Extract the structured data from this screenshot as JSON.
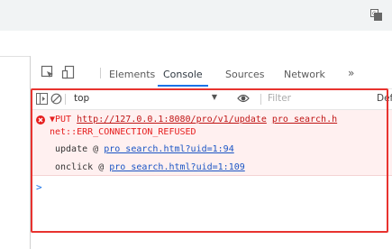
{
  "browser": {
    "translate_icon": "translate-icon"
  },
  "devtools": {
    "tabs": [
      "Elements",
      "Console",
      "Sources",
      "Network"
    ],
    "active_tab": "Console",
    "more_tabs": "»",
    "icons": [
      "inspect-element-icon",
      "device-toggle-icon"
    ]
  },
  "console_toolbar": {
    "context": "top",
    "filter_placeholder": "Filter",
    "levels": "Def"
  },
  "error": {
    "method": "▼PUT",
    "url": "http://127.0.0.1:8080/pro/v1/update",
    "source": "pro search.h",
    "message": "net::ERR_CONNECTION_REFUSED",
    "stack": [
      {
        "fn": "update",
        "at": "@",
        "link": "pro search.html?uid=1:94"
      },
      {
        "fn": "onclick",
        "at": "@",
        "link": "pro search.html?uid=1:109"
      }
    ]
  },
  "console_prompt": ">",
  "colors": {
    "error_text": "#e61e1e",
    "error_bg": "#fff0f0",
    "link": "#1a55c5",
    "highlight": "#e8332f",
    "accent": "#1a73e8"
  }
}
